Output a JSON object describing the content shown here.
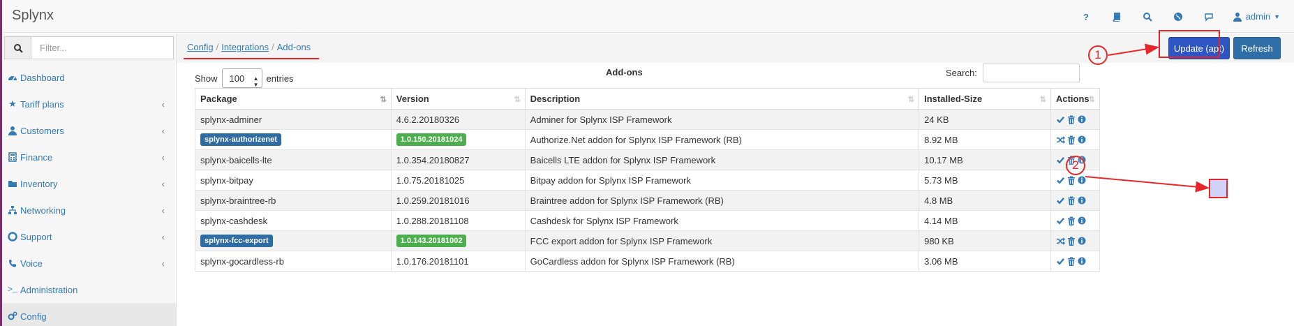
{
  "app": {
    "title": "Splynx"
  },
  "topnav": {
    "icons": [
      "help-icon",
      "book-icon",
      "search-icon",
      "globe-icon",
      "chat-icon"
    ],
    "user_label": "admin"
  },
  "sidebar": {
    "filter_placeholder": "Filter...",
    "items": [
      {
        "label": "Dashboard",
        "icon": "dashboard-icon",
        "has_submenu": false
      },
      {
        "label": "Tariff plans",
        "icon": "star-icon",
        "has_submenu": true
      },
      {
        "label": "Customers",
        "icon": "user-icon",
        "has_submenu": true
      },
      {
        "label": "Finance",
        "icon": "calculator-icon",
        "has_submenu": true
      },
      {
        "label": "Inventory",
        "icon": "folder-icon",
        "has_submenu": true
      },
      {
        "label": "Networking",
        "icon": "sitemap-icon",
        "has_submenu": true
      },
      {
        "label": "Support",
        "icon": "lifebuoy-icon",
        "has_submenu": true
      },
      {
        "label": "Voice",
        "icon": "phone-icon",
        "has_submenu": true
      },
      {
        "label": "Administration",
        "icon": "terminal-icon",
        "has_submenu": false
      },
      {
        "label": "Config",
        "icon": "cogs-icon",
        "has_submenu": false,
        "active": true
      }
    ]
  },
  "breadcrumb": {
    "items": [
      "Config",
      "Integrations",
      "Add-ons"
    ]
  },
  "actions": {
    "update": "Update (apt)",
    "refresh": "Refresh"
  },
  "table": {
    "show_label": "Show",
    "page_size": "100",
    "entries_label": "entries",
    "title": "Add-ons",
    "search_label": "Search:",
    "columns": [
      "Package",
      "Version",
      "Description",
      "Installed-Size",
      "Actions"
    ],
    "rows": [
      {
        "package": "splynx-adminer",
        "version": "4.6.2.20180326",
        "description": "Adminer for Splynx ISP Framework",
        "size": "24 KB",
        "highlight": false
      },
      {
        "package": "splynx-authorizenet",
        "version": "1.0.150.20181024",
        "description": "Authorize.Net addon for Splynx ISP Framework (RB)",
        "size": "8.92 MB",
        "highlight": true
      },
      {
        "package": "splynx-baicells-lte",
        "version": "1.0.354.20180827",
        "description": "Baicells LTE addon for Splynx ISP Framework",
        "size": "10.17 MB",
        "highlight": false
      },
      {
        "package": "splynx-bitpay",
        "version": "1.0.75.20181025",
        "description": "Bitpay addon for Splynx ISP Framework",
        "size": "5.73 MB",
        "highlight": false
      },
      {
        "package": "splynx-braintree-rb",
        "version": "1.0.259.20181016",
        "description": "Braintree addon for Splynx ISP Framework (RB)",
        "size": "4.8 MB",
        "highlight": false
      },
      {
        "package": "splynx-cashdesk",
        "version": "1.0.288.20181108",
        "description": "Cashdesk for Splynx ISP Framework",
        "size": "4.14 MB",
        "highlight": false
      },
      {
        "package": "splynx-fcc-export",
        "version": "1.0.143.20181002",
        "description": "FCC export addon for Splynx ISP Framework",
        "size": "980 KB",
        "highlight": true
      },
      {
        "package": "splynx-gocardless-rb",
        "version": "1.0.176.20181101",
        "description": "GoCardless addon for Splynx ISP Framework (RB)",
        "size": "3.06 MB",
        "highlight": false
      }
    ]
  },
  "annotations": {
    "step1": "1",
    "step2": "2"
  },
  "colors": {
    "accent": "#337ab7",
    "annotation": "#e8262a",
    "update_button": "#2e55c4",
    "version_badge": "#4cae4c",
    "package_badge": "#2e6da4"
  }
}
